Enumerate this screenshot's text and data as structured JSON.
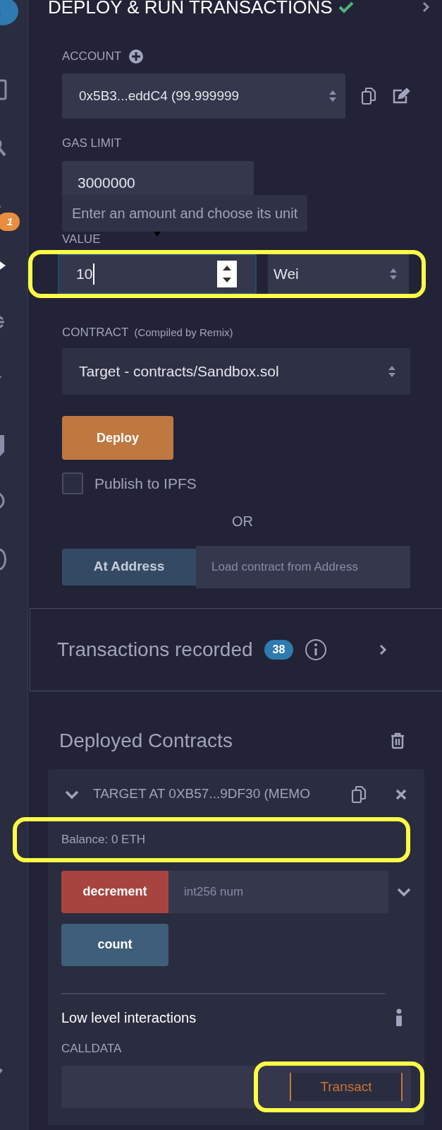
{
  "sidebar": {
    "badge": "1"
  },
  "header": {
    "title": "DEPLOY & RUN TRANSACTIONS",
    "compiled_ok": true
  },
  "account": {
    "label": "ACCOUNT",
    "value": "0x5B3...eddC4 (99.999999"
  },
  "gas_limit": {
    "label": "GAS LIMIT",
    "value": "3000000"
  },
  "value": {
    "label": "VALUE",
    "tooltip": "Enter an amount and choose its unit",
    "amount": "10",
    "unit": "Wei"
  },
  "contract": {
    "label": "CONTRACT",
    "note": "(Compiled by Remix)",
    "value": "Target - contracts/Sandbox.sol"
  },
  "deploy_button": "Deploy",
  "publish": {
    "label": "Publish to IPFS",
    "checked": false
  },
  "or_text": "OR",
  "at_address": {
    "button": "At Address",
    "placeholder": "Load contract from Address"
  },
  "transactions": {
    "label": "Transactions recorded",
    "count": "38"
  },
  "deployed": {
    "title": "Deployed Contracts",
    "instances": [
      {
        "name": "TARGET AT 0XB57...9DF30 (MEMO",
        "expanded": true,
        "balance": "Balance: 0 ETH",
        "functions": [
          {
            "name": "decrement",
            "kind": "transact",
            "placeholder": "int256 num"
          },
          {
            "name": "count",
            "kind": "call"
          }
        ],
        "low_level": {
          "title": "Low level interactions",
          "label": "CALLDATA",
          "button": "Transact"
        }
      }
    ]
  }
}
